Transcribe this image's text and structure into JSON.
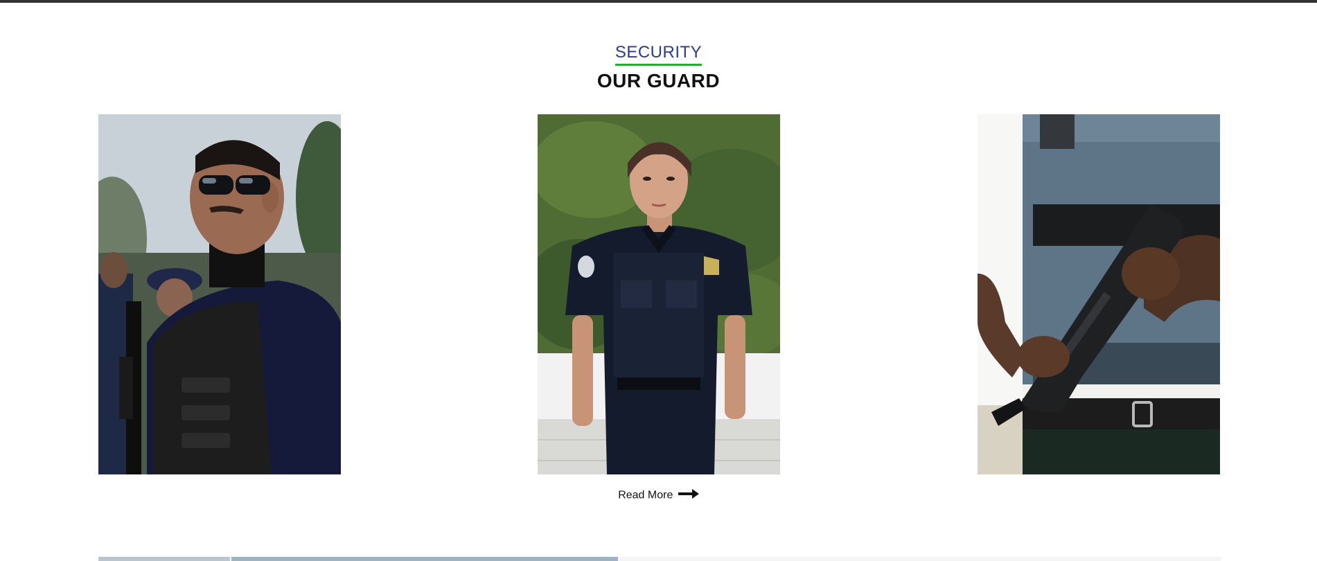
{
  "section": {
    "kicker": "SECURITY",
    "title": "OUR GUARD"
  },
  "guards": [
    {
      "photo_name": "guard-sunglasses-photo"
    },
    {
      "photo_name": "guard-female-officer-photo"
    },
    {
      "photo_name": "guard-armed-vest-photo"
    }
  ],
  "read_more": {
    "label": "Read More",
    "icon": "arrow-right-icon"
  },
  "colors": {
    "kicker": "#2b3a8f",
    "underline": "#2da836",
    "top_bar": "#333333"
  }
}
